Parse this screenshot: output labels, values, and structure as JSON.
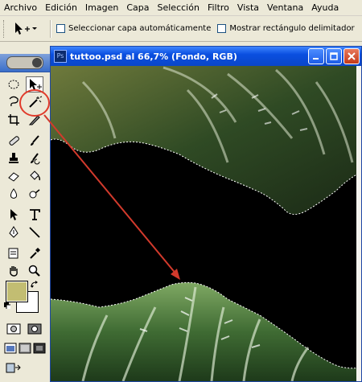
{
  "menubar": {
    "items": [
      "Archivo",
      "Edición",
      "Imagen",
      "Capa",
      "Selección",
      "Filtro",
      "Vista",
      "Ventana",
      "Ayuda"
    ]
  },
  "options_bar": {
    "tool_icon": "move-tool-icon",
    "auto_select_label": "Seleccionar capa automáticamente",
    "auto_select_checked": false,
    "show_bounds_label": "Mostrar rectángulo delimitador",
    "show_bounds_checked": false
  },
  "toolbox": {
    "active_tool": "magic-wand-tool",
    "foreground_color": "#c2bd72",
    "background_color": "#ffffff"
  },
  "document": {
    "title": "tuttoo.psd al 66,7% (Fondo, RGB)",
    "window_buttons": [
      "minimize",
      "maximize",
      "close"
    ]
  },
  "annotation": {
    "circle_color": "#e03a2a",
    "arrow_color": "#d23a2c"
  }
}
